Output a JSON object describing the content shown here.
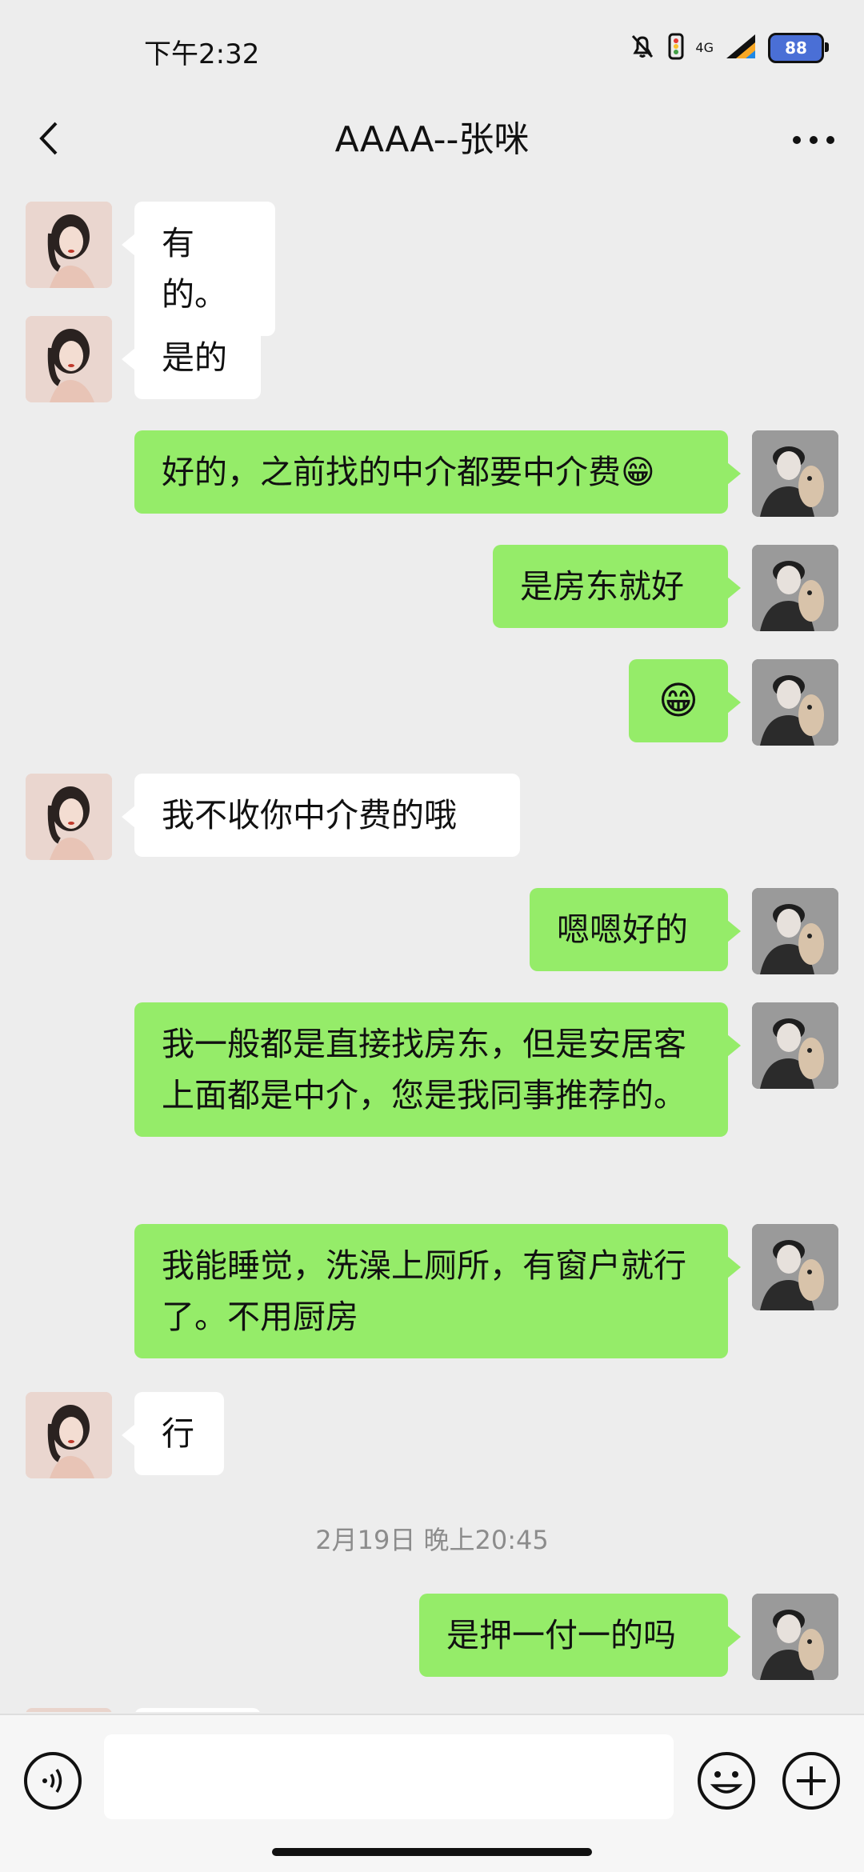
{
  "status_bar": {
    "time": "下午2:32",
    "network": "4G",
    "battery": "88"
  },
  "header": {
    "title": "AAAA--张咪",
    "back_icon": "chevron-left-icon",
    "more_icon": "more-dots-icon"
  },
  "messages": [
    {
      "from": "other",
      "text": "有的。"
    },
    {
      "from": "other",
      "text": "是的"
    },
    {
      "from": "me",
      "text": "好的，之前找的中介都要中介费😁"
    },
    {
      "from": "me",
      "text": "是房东就好"
    },
    {
      "from": "me",
      "text": "😁"
    },
    {
      "from": "other",
      "text": "我不收你中介费的哦"
    },
    {
      "from": "me",
      "text": "嗯嗯好的"
    },
    {
      "from": "me",
      "text": "我一般都是直接找房东，但是安居客上面都是中介，您是我同事推荐的。"
    },
    {
      "from": "me",
      "text": "我能睡觉，洗澡上厕所，有窗户就行了。不用厨房"
    },
    {
      "from": "other",
      "text": "行"
    },
    {
      "from": "me",
      "text": "是押一付一的吗"
    }
  ],
  "timestamp": "2月19日 晚上20:45",
  "input_bar": {
    "placeholder": "",
    "voice_icon": "voice-icon",
    "emoji_icon": "emoji-icon",
    "plus_icon": "plus-icon"
  },
  "colors": {
    "outgoing_bubble": "#95ec69",
    "incoming_bubble": "#ffffff",
    "background": "#ededed"
  }
}
